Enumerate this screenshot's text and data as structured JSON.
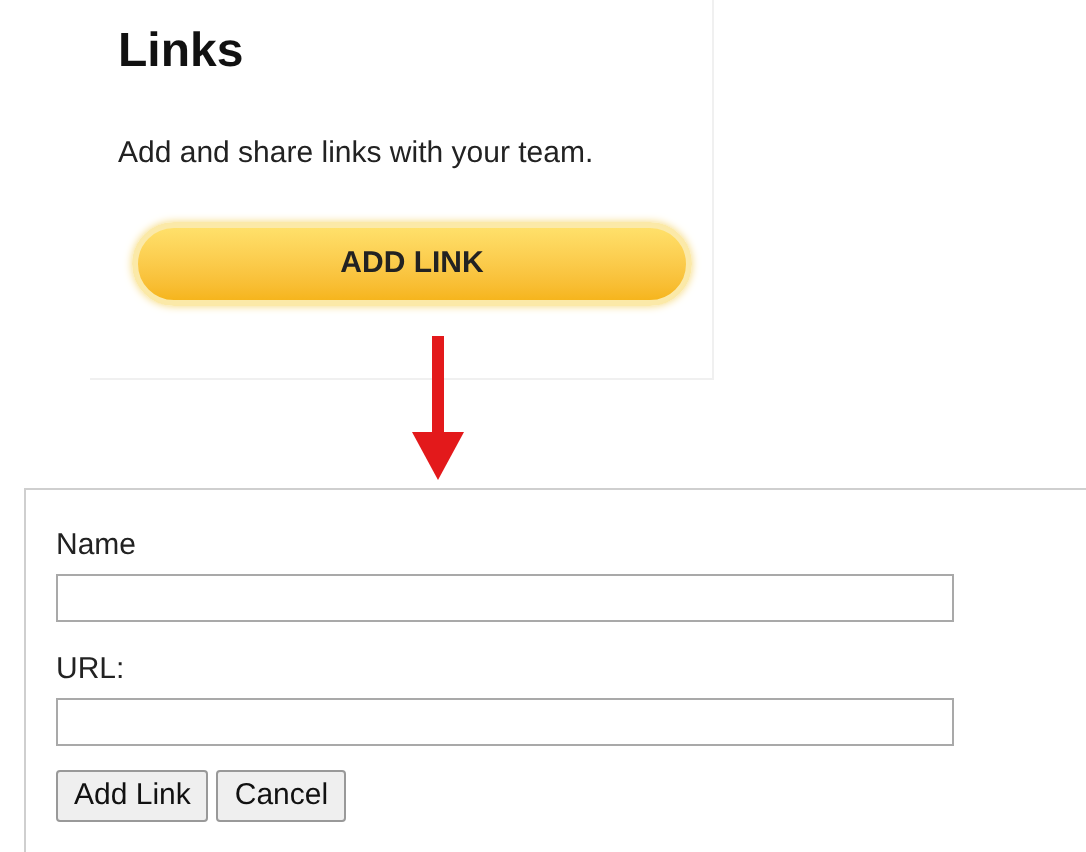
{
  "links_panel": {
    "title": "Links",
    "description": "Add and share links with your team.",
    "button": "ADD LINK"
  },
  "form": {
    "fields": [
      {
        "label": "Name"
      },
      {
        "label": "URL:"
      }
    ],
    "buttons": [
      "Add Link",
      "Cancel"
    ]
  }
}
